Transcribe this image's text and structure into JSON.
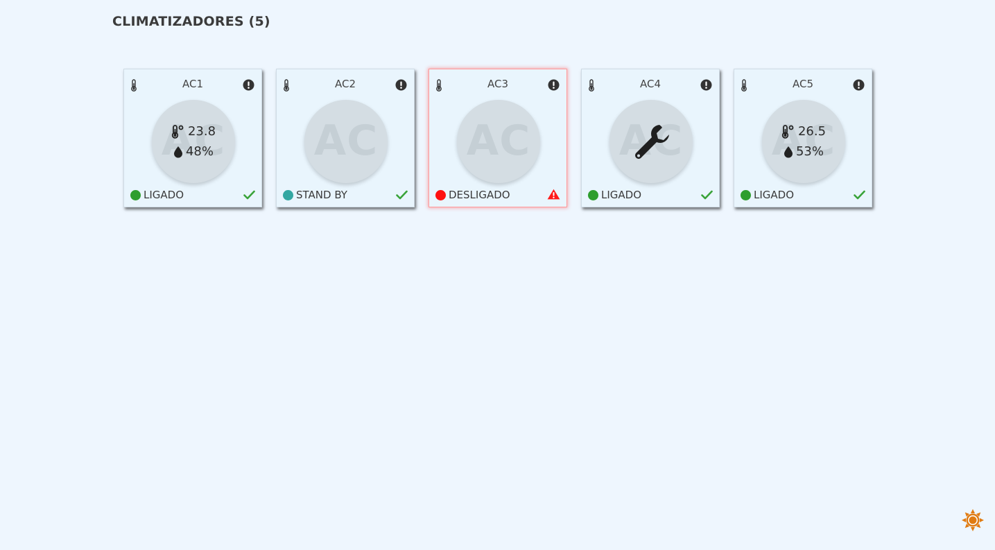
{
  "page": {
    "title": "CLIMATIZADORES (5)"
  },
  "colors": {
    "status_on": "#2e9e2e",
    "status_standby": "#33a7a2",
    "status_off": "#ff1111",
    "check": "#39a339",
    "warning": "#ff1a1a",
    "theme_toggle": "#e07b12"
  },
  "watermark_text": "AC",
  "cards": [
    {
      "name": "AC1",
      "status": "LIGADO",
      "status_color": "#2e9e2e",
      "temperature": "23.8",
      "humidity": "48%",
      "icons": [
        "thermometer-icon",
        "info-icon",
        "check-icon"
      ]
    },
    {
      "name": "AC2",
      "status": "STAND BY",
      "status_color": "#33a7a2",
      "icons": [
        "thermometer-icon",
        "info-icon",
        "check-icon"
      ]
    },
    {
      "name": "AC3",
      "status": "DESLIGADO",
      "status_color": "#ff1111",
      "icons": [
        "thermometer-icon",
        "info-icon",
        "warning-icon"
      ]
    },
    {
      "name": "AC4",
      "status": "LIGADO",
      "status_color": "#2e9e2e",
      "icons": [
        "thermometer-icon",
        "info-icon",
        "wrench-icon",
        "check-icon"
      ]
    },
    {
      "name": "AC5",
      "status": "LIGADO",
      "status_color": "#2e9e2e",
      "temperature": "26.5",
      "humidity": "53%",
      "icons": [
        "thermometer-icon",
        "info-icon",
        "check-icon"
      ]
    }
  ],
  "theme_toggle": {
    "icon": "sun-icon"
  }
}
